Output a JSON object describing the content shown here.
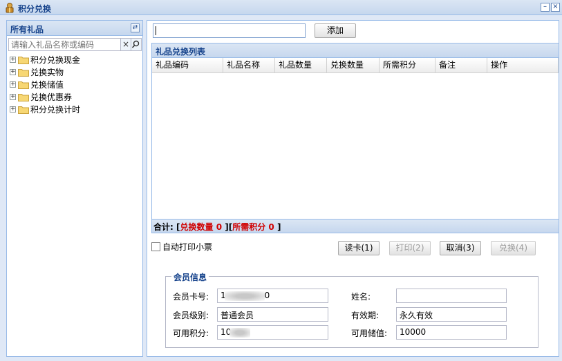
{
  "window": {
    "title": "积分兑换",
    "minimize": "–",
    "close": "×"
  },
  "left": {
    "header": "所有礼品",
    "search_placeholder": "请输入礼品名称或编码",
    "tree": [
      {
        "label": "积分兑换现金"
      },
      {
        "label": "兑换实物"
      },
      {
        "label": "兑换储值"
      },
      {
        "label": "兑换优惠券"
      },
      {
        "label": "积分兑换计时"
      }
    ]
  },
  "right": {
    "add_value": "",
    "add_button": "添加",
    "grid": {
      "title": "礼品兑换列表",
      "columns": [
        "礼品编码",
        "礼品名称",
        "礼品数量",
        "兑换数量",
        "所需积分",
        "备注",
        "操作"
      ],
      "rows": [],
      "footer": {
        "total_label": "合计:",
        "bracket_open": "[",
        "bracket_close": "]",
        "exchange_qty_label": "兑换数量",
        "exchange_qty_value": "0",
        "points_label": "所需积分",
        "points_value": "0"
      }
    },
    "auto_print": {
      "label": "自动打印小票",
      "checked": false
    },
    "buttons": {
      "read_card": "读卡(1)",
      "print": "打印(2)",
      "cancel": "取消(3)",
      "exchange": "兑换(4)"
    },
    "member": {
      "legend": "会员信息",
      "card_no_label": "会员卡号:",
      "card_no_prefix": "1",
      "card_no_suffix": "0",
      "name_label": "姓名:",
      "name_value": "",
      "level_label": "会员级别:",
      "level_value": "普通会员",
      "validity_label": "有效期:",
      "validity_value": "永久有效",
      "points_label": "可用积分:",
      "points_prefix": "10",
      "balance_label": "可用储值:",
      "balance_value": "10000"
    }
  },
  "colors": {
    "panel_border": "#99bbe8",
    "header_text": "#15428b",
    "highlight_red": "#d00000"
  }
}
